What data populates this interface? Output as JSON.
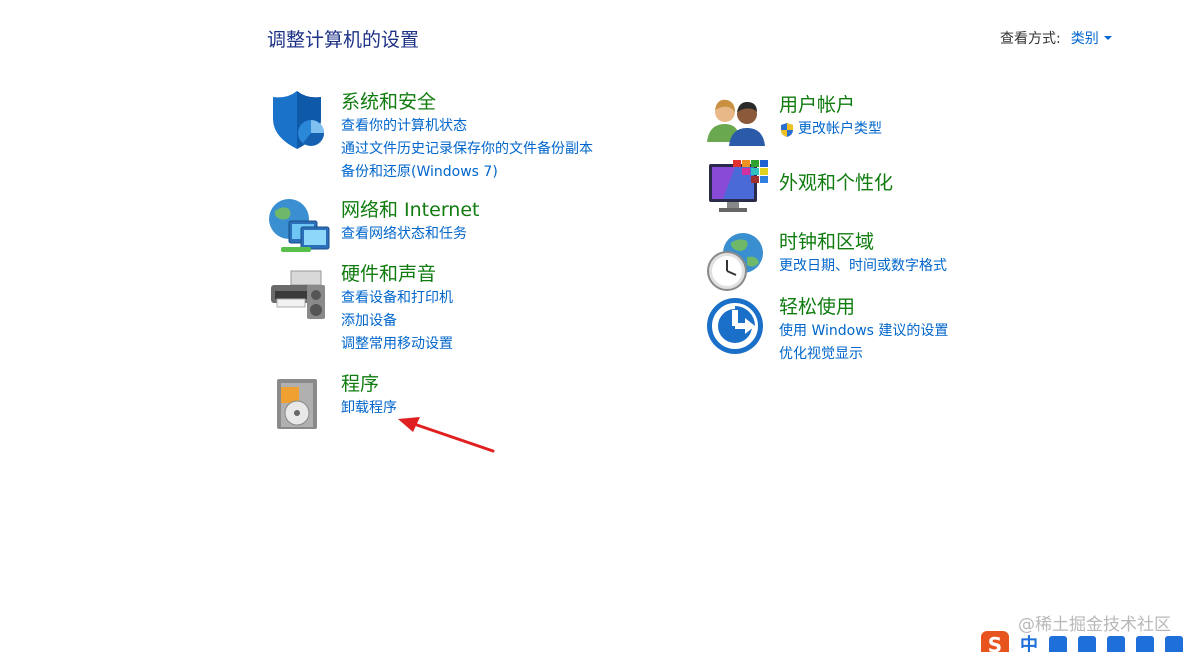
{
  "header": {
    "title": "调整计算机的设置",
    "view_by_label": "查看方式:",
    "view_by_value": "类别"
  },
  "categories": [
    {
      "title": "系统和安全",
      "icon": "shield-icon",
      "links": [
        "查看你的计算机状态",
        "通过文件历史记录保存你的文件备份副本",
        "备份和还原(Windows 7)"
      ]
    },
    {
      "title": "网络和 Internet",
      "icon": "network-icon",
      "links": [
        "查看网络状态和任务"
      ]
    },
    {
      "title": "硬件和声音",
      "icon": "printer-icon",
      "links": [
        "查看设备和打印机",
        "添加设备",
        "调整常用移动设置"
      ]
    },
    {
      "title": "程序",
      "icon": "programs-icon",
      "links": [
        "卸载程序"
      ]
    },
    {
      "title": "用户帐户",
      "icon": "users-icon",
      "links": [
        "更改帐户类型"
      ]
    },
    {
      "title": "外观和个性化",
      "icon": "appearance-icon",
      "links": []
    },
    {
      "title": "时钟和区域",
      "icon": "clock-globe-icon",
      "links": [
        "更改日期、时间或数字格式"
      ]
    },
    {
      "title": "轻松使用",
      "icon": "ease-of-access-icon",
      "links": [
        "使用 Windows 建议的设置",
        "优化视觉显示"
      ]
    }
  ],
  "watermark": "@稀土掘金技术社区",
  "ime": {
    "logo": "S",
    "mode": "中"
  },
  "colors": {
    "title_blue": "#1e3287",
    "category_green": "#107c10",
    "link_blue": "#0066cc",
    "annotation_red": "#e02020"
  }
}
